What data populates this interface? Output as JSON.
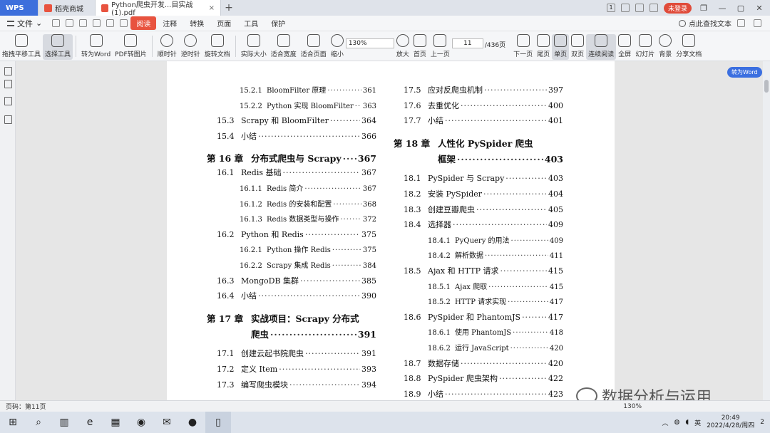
{
  "tabs": [
    {
      "label": "WPS"
    },
    {
      "label": "稻壳商城"
    },
    {
      "label": "Python爬虫开发...目实战(1).pdf"
    }
  ],
  "titlebar": {
    "page_badge": "1",
    "login_label": "未登录"
  },
  "menu": {
    "file_label": "文件",
    "items": [
      "阅读",
      "注释",
      "转换",
      "页面",
      "工具",
      "保护"
    ],
    "search_label": "点此查找文本"
  },
  "toolbar": {
    "pan": "拖拽平移工具",
    "select": "选择工具",
    "to_word": "转为Word",
    "pdf_to_img": "PDF转图片",
    "rotate_cw": "顺时针",
    "rotate_ccw": "逆时针",
    "rotate_doc": "旋转文档",
    "actual_size": "实际大小",
    "fit_width": "适合宽度",
    "fit_page": "适合页面",
    "zoom_out": "缩小",
    "zoom_value": "130%",
    "zoom_in": "放大",
    "first_page": "首页",
    "prev_page": "上一页",
    "current_page": "11",
    "total_pages": "/436页",
    "next_page": "下一页",
    "last_page": "尾页",
    "single": "单页",
    "double": "双页",
    "continuous": "连续阅读",
    "fullscreen": "全屏",
    "slideshow": "幻灯片",
    "background": "背景",
    "share": "分享文档"
  },
  "to_word_badge": "转为Word",
  "toc": {
    "left": [
      {
        "num": "15.2.1",
        "title": "BloomFilter 原理",
        "page": "361",
        "level": "sub"
      },
      {
        "num": "15.2.2",
        "title": "Python 实现 BloomFilter",
        "page": "363",
        "level": "sub"
      },
      {
        "num": "15.3",
        "title": "Scrapy 和 BloomFilter",
        "page": "364",
        "level": "sec"
      },
      {
        "num": "15.4",
        "title": "小结",
        "page": "366",
        "level": "sec"
      },
      {
        "num": "第 16 章",
        "title": "分布式爬虫与 Scrapy",
        "page": "367",
        "level": "chapter"
      },
      {
        "num": "16.1",
        "title": "Redis 基础",
        "page": "367",
        "level": "sec"
      },
      {
        "num": "16.1.1",
        "title": "Redis 简介",
        "page": "367",
        "level": "sub"
      },
      {
        "num": "16.1.2",
        "title": "Redis 的安装和配置",
        "page": "368",
        "level": "sub"
      },
      {
        "num": "16.1.3",
        "title": "Redis 数据类型与操作",
        "page": "372",
        "level": "sub"
      },
      {
        "num": "16.2",
        "title": "Python 和 Redis",
        "page": "375",
        "level": "sec"
      },
      {
        "num": "16.2.1",
        "title": "Python 操作 Redis",
        "page": "375",
        "level": "sub"
      },
      {
        "num": "16.2.2",
        "title": "Scrapy 集成 Redis",
        "page": "384",
        "level": "sub"
      },
      {
        "num": "16.3",
        "title": "MongoDB 集群",
        "page": "385",
        "level": "sec"
      },
      {
        "num": "16.4",
        "title": "小结",
        "page": "390",
        "level": "sec"
      },
      {
        "num": "第 17 章",
        "title": "实战项目：Scrapy 分布式",
        "page": "",
        "level": "chapter"
      },
      {
        "num": "",
        "title": "爬虫",
        "page": "391",
        "level": "chapter-cont"
      },
      {
        "num": "17.1",
        "title": "创建云起书院爬虫",
        "page": "391",
        "level": "sec"
      },
      {
        "num": "17.2",
        "title": "定义 Item",
        "page": "393",
        "level": "sec"
      },
      {
        "num": "17.3",
        "title": "编写爬虫模块",
        "page": "394",
        "level": "sec"
      }
    ],
    "right": [
      {
        "num": "17.5",
        "title": "应对反爬虫机制",
        "page": "397",
        "level": "sec"
      },
      {
        "num": "17.6",
        "title": "去重优化",
        "page": "400",
        "level": "sec"
      },
      {
        "num": "17.7",
        "title": "小结",
        "page": "401",
        "level": "sec"
      },
      {
        "num": "第 18 章",
        "title": "人性化 PySpider 爬虫",
        "page": "",
        "level": "chapter"
      },
      {
        "num": "",
        "title": "框架",
        "page": "403",
        "level": "chapter-cont"
      },
      {
        "num": "18.1",
        "title": "PySpider 与 Scrapy",
        "page": "403",
        "level": "sec"
      },
      {
        "num": "18.2",
        "title": "安装 PySpider",
        "page": "404",
        "level": "sec"
      },
      {
        "num": "18.3",
        "title": "创建豆瓣爬虫",
        "page": "405",
        "level": "sec"
      },
      {
        "num": "18.4",
        "title": "选择器",
        "page": "409",
        "level": "sec"
      },
      {
        "num": "18.4.1",
        "title": "PyQuery 的用法",
        "page": "409",
        "level": "sub"
      },
      {
        "num": "18.4.2",
        "title": "解析数据",
        "page": "411",
        "level": "sub"
      },
      {
        "num": "18.5",
        "title": "Ajax 和 HTTP 请求",
        "page": "415",
        "level": "sec"
      },
      {
        "num": "18.5.1",
        "title": "Ajax 爬取",
        "page": "415",
        "level": "sub"
      },
      {
        "num": "18.5.2",
        "title": "HTTP 请求实现",
        "page": "417",
        "level": "sub"
      },
      {
        "num": "18.6",
        "title": "PySpider 和 PhantomJS",
        "page": "417",
        "level": "sec"
      },
      {
        "num": "18.6.1",
        "title": "使用 PhantomJS",
        "page": "418",
        "level": "sub"
      },
      {
        "num": "18.6.2",
        "title": "运行 JavaScript",
        "page": "420",
        "level": "sub"
      },
      {
        "num": "18.7",
        "title": "数据存储",
        "page": "420",
        "level": "sec"
      },
      {
        "num": "18.8",
        "title": "PySpider 爬虫架构",
        "page": "422",
        "level": "sec"
      },
      {
        "num": "18.9",
        "title": "小结",
        "page": "423",
        "level": "sec"
      }
    ]
  },
  "status": {
    "page_label": "页码：第11页",
    "zoom": "130%"
  },
  "watermark": "数据分析与运用",
  "taskbar": {
    "ime": "英",
    "time": "20:49",
    "date": "2022/4/28/周四",
    "notif": "2"
  }
}
